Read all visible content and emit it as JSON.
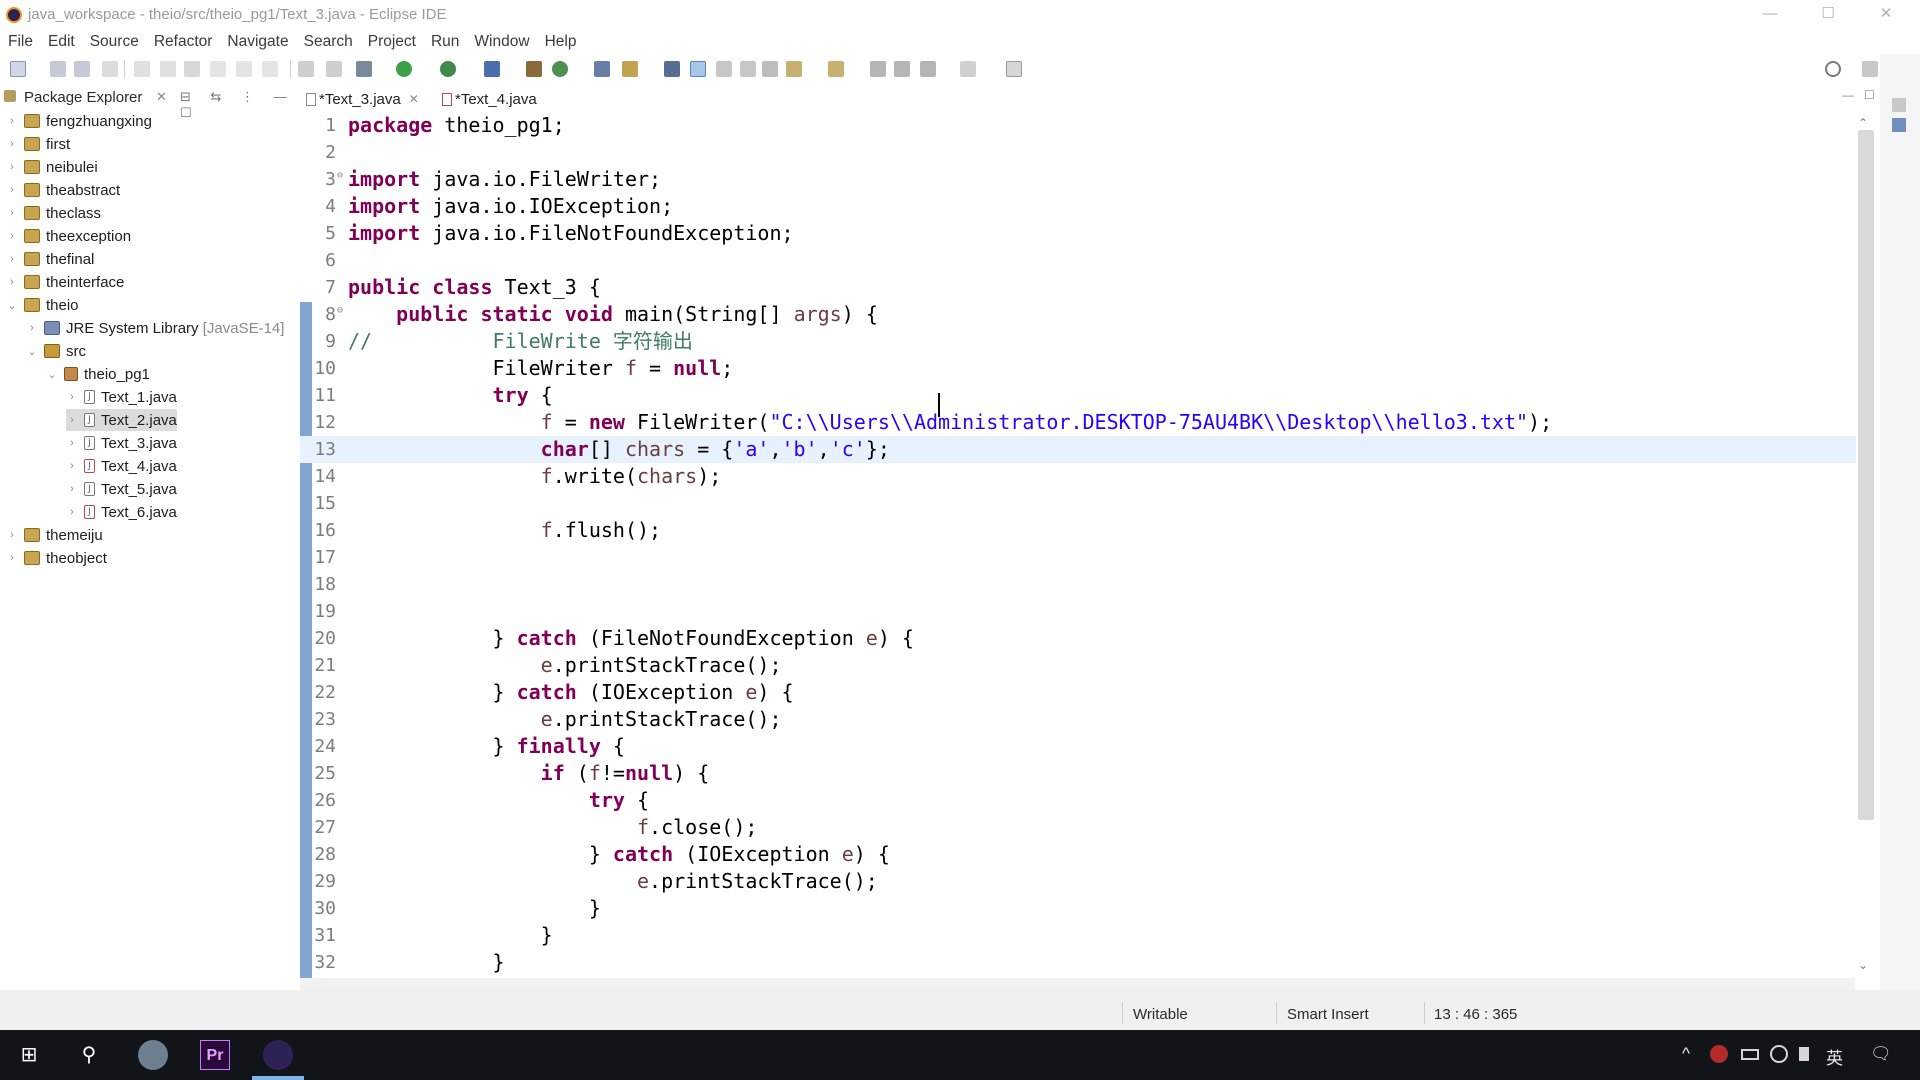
{
  "window": {
    "title": "java_workspace - theio/src/theio_pg1/Text_3.java - Eclipse IDE",
    "controls": {
      "minimize": "—",
      "maximize": "☐",
      "close": "✕"
    }
  },
  "menu": [
    "File",
    "Edit",
    "Source",
    "Refactor",
    "Navigate",
    "Search",
    "Project",
    "Run",
    "Window",
    "Help"
  ],
  "package_explorer": {
    "title": "Package Explorer",
    "close": "✕",
    "tools": "⊟ ⇆ ⋮ —  ☐",
    "tree": [
      {
        "label": "fengzhuangxing",
        "twisty": "›",
        "icon": "project-icon"
      },
      {
        "label": "first",
        "twisty": "›",
        "icon": "project-icon"
      },
      {
        "label": "neibulei",
        "twisty": "›",
        "icon": "project-icon"
      },
      {
        "label": "theabstract",
        "twisty": "›",
        "icon": "project-icon"
      },
      {
        "label": "theclass",
        "twisty": "›",
        "icon": "project-icon"
      },
      {
        "label": "theexception",
        "twisty": "›",
        "icon": "project-icon"
      },
      {
        "label": "thefinal",
        "twisty": "›",
        "icon": "project-icon"
      },
      {
        "label": "theinterface",
        "twisty": "›",
        "icon": "project-icon"
      },
      {
        "label": "theio",
        "twisty": "⌄",
        "icon": "project-icon"
      },
      {
        "label": "JRE System Library",
        "decoration": "[JavaSE-14]",
        "twisty": "›",
        "icon": "library-icon"
      },
      {
        "label": "src",
        "twisty": "⌄",
        "icon": "source-folder-icon"
      },
      {
        "label": "theio_pg1",
        "twisty": "⌄",
        "icon": "package-icon"
      },
      {
        "label": "Text_1.java",
        "twisty": "›",
        "icon": "java-file-icon"
      },
      {
        "label": "Text_2.java",
        "twisty": "›",
        "icon": "java-file-icon"
      },
      {
        "label": "Text_3.java",
        "twisty": "›",
        "icon": "java-file-icon"
      },
      {
        "label": "Text_4.java",
        "twisty": "›",
        "icon": "java-file-error-icon"
      },
      {
        "label": "Text_5.java",
        "twisty": "›",
        "icon": "java-file-icon"
      },
      {
        "label": "Text_6.java",
        "twisty": "›",
        "icon": "java-file-error-icon"
      },
      {
        "label": "themeiju",
        "twisty": "›",
        "icon": "project-icon"
      },
      {
        "label": "theobject",
        "twisty": "›",
        "icon": "project-icon"
      }
    ]
  },
  "editor": {
    "tabs": [
      {
        "label": "*Text_3.java",
        "close": "✕",
        "active": true
      },
      {
        "label": "*Text_4.java",
        "close": "",
        "active": false
      }
    ],
    "current_line": 13,
    "lines": [
      {
        "n": "1",
        "tokens": [
          {
            "t": "package",
            "c": "kw"
          },
          {
            "t": " theio_pg1;",
            "c": ""
          }
        ]
      },
      {
        "n": "2",
        "tokens": []
      },
      {
        "n": "3",
        "fold": "⊖",
        "tokens": [
          {
            "t": "import",
            "c": "kw"
          },
          {
            "t": " java.io.FileWriter;",
            "c": ""
          }
        ]
      },
      {
        "n": "4",
        "tokens": [
          {
            "t": "import",
            "c": "kw"
          },
          {
            "t": " java.io.IOException;",
            "c": ""
          }
        ]
      },
      {
        "n": "5",
        "tokens": [
          {
            "t": "import",
            "c": "kw"
          },
          {
            "t": " java.io.FileNotFoundException;",
            "c": ""
          }
        ]
      },
      {
        "n": "6",
        "tokens": []
      },
      {
        "n": "7",
        "tokens": [
          {
            "t": "public",
            "c": "kw"
          },
          {
            "t": " ",
            "c": ""
          },
          {
            "t": "class",
            "c": "kw"
          },
          {
            "t": " Text_3 {",
            "c": ""
          }
        ]
      },
      {
        "n": "8",
        "fold": "⊖",
        "tokens": [
          {
            "t": "    ",
            "c": ""
          },
          {
            "t": "public",
            "c": "kw"
          },
          {
            "t": " ",
            "c": ""
          },
          {
            "t": "static",
            "c": "kw"
          },
          {
            "t": " ",
            "c": ""
          },
          {
            "t": "void",
            "c": "kw"
          },
          {
            "t": " main(String[] ",
            "c": ""
          },
          {
            "t": "args",
            "c": "var"
          },
          {
            "t": ") {",
            "c": ""
          }
        ]
      },
      {
        "n": "9",
        "tokens": [
          {
            "t": "//          FileWrite 字符输出",
            "c": "cmt"
          }
        ]
      },
      {
        "n": "10",
        "tokens": [
          {
            "t": "            FileWriter ",
            "c": ""
          },
          {
            "t": "f",
            "c": "var"
          },
          {
            "t": " = ",
            "c": ""
          },
          {
            "t": "null",
            "c": "kw"
          },
          {
            "t": ";",
            "c": ""
          }
        ]
      },
      {
        "n": "11",
        "tokens": [
          {
            "t": "            ",
            "c": ""
          },
          {
            "t": "try",
            "c": "kw"
          },
          {
            "t": " {",
            "c": ""
          }
        ]
      },
      {
        "n": "12",
        "tokens": [
          {
            "t": "                ",
            "c": ""
          },
          {
            "t": "f",
            "c": "var"
          },
          {
            "t": " = ",
            "c": ""
          },
          {
            "t": "new",
            "c": "kw"
          },
          {
            "t": " FileWriter(",
            "c": ""
          },
          {
            "t": "\"C:\\\\Users\\\\Administrator.DESKTOP-75AU4BK\\\\Desktop\\\\hello3.txt\"",
            "c": "str"
          },
          {
            "t": ");",
            "c": ""
          }
        ]
      },
      {
        "n": "13",
        "tokens": [
          {
            "t": "                ",
            "c": ""
          },
          {
            "t": "char",
            "c": "kw"
          },
          {
            "t": "[] ",
            "c": ""
          },
          {
            "t": "chars",
            "c": "var"
          },
          {
            "t": " = {",
            "c": ""
          },
          {
            "t": "'a'",
            "c": "str"
          },
          {
            "t": ",",
            "c": ""
          },
          {
            "t": "'b'",
            "c": "str"
          },
          {
            "t": ",",
            "c": ""
          },
          {
            "t": "'c'",
            "c": "str"
          },
          {
            "t": "};",
            "c": ""
          }
        ]
      },
      {
        "n": "14",
        "tokens": [
          {
            "t": "                ",
            "c": ""
          },
          {
            "t": "f",
            "c": "var"
          },
          {
            "t": ".write(",
            "c": ""
          },
          {
            "t": "chars",
            "c": "var"
          },
          {
            "t": ");",
            "c": ""
          }
        ]
      },
      {
        "n": "15",
        "tokens": []
      },
      {
        "n": "16",
        "tokens": [
          {
            "t": "                ",
            "c": ""
          },
          {
            "t": "f",
            "c": "var"
          },
          {
            "t": ".flush();",
            "c": ""
          }
        ]
      },
      {
        "n": "17",
        "tokens": []
      },
      {
        "n": "18",
        "tokens": []
      },
      {
        "n": "19",
        "tokens": []
      },
      {
        "n": "20",
        "tokens": [
          {
            "t": "            } ",
            "c": ""
          },
          {
            "t": "catch",
            "c": "kw"
          },
          {
            "t": " (FileNotFoundException ",
            "c": ""
          },
          {
            "t": "e",
            "c": "var"
          },
          {
            "t": ") {",
            "c": ""
          }
        ]
      },
      {
        "n": "21",
        "tokens": [
          {
            "t": "                ",
            "c": ""
          },
          {
            "t": "e",
            "c": "var"
          },
          {
            "t": ".printStackTrace();",
            "c": ""
          }
        ]
      },
      {
        "n": "22",
        "tokens": [
          {
            "t": "            } ",
            "c": ""
          },
          {
            "t": "catch",
            "c": "kw"
          },
          {
            "t": " (IOException ",
            "c": ""
          },
          {
            "t": "e",
            "c": "var"
          },
          {
            "t": ") {",
            "c": ""
          }
        ]
      },
      {
        "n": "23",
        "tokens": [
          {
            "t": "                ",
            "c": ""
          },
          {
            "t": "e",
            "c": "var"
          },
          {
            "t": ".printStackTrace();",
            "c": ""
          }
        ]
      },
      {
        "n": "24",
        "tokens": [
          {
            "t": "            } ",
            "c": ""
          },
          {
            "t": "finally",
            "c": "kw"
          },
          {
            "t": " {",
            "c": ""
          }
        ]
      },
      {
        "n": "25",
        "tokens": [
          {
            "t": "                ",
            "c": ""
          },
          {
            "t": "if",
            "c": "kw"
          },
          {
            "t": " (",
            "c": ""
          },
          {
            "t": "f",
            "c": "var"
          },
          {
            "t": "!=",
            "c": ""
          },
          {
            "t": "null",
            "c": "kw"
          },
          {
            "t": ") {",
            "c": ""
          }
        ]
      },
      {
        "n": "26",
        "tokens": [
          {
            "t": "                    ",
            "c": ""
          },
          {
            "t": "try",
            "c": "kw"
          },
          {
            "t": " {",
            "c": ""
          }
        ]
      },
      {
        "n": "27",
        "tokens": [
          {
            "t": "                        ",
            "c": ""
          },
          {
            "t": "f",
            "c": "var"
          },
          {
            "t": ".close();",
            "c": ""
          }
        ]
      },
      {
        "n": "28",
        "tokens": [
          {
            "t": "                    } ",
            "c": ""
          },
          {
            "t": "catch",
            "c": "kw"
          },
          {
            "t": " (IOException ",
            "c": ""
          },
          {
            "t": "e",
            "c": "var"
          },
          {
            "t": ") {",
            "c": ""
          }
        ]
      },
      {
        "n": "29",
        "tokens": [
          {
            "t": "                        ",
            "c": ""
          },
          {
            "t": "e",
            "c": "var"
          },
          {
            "t": ".printStackTrace();",
            "c": ""
          }
        ]
      },
      {
        "n": "30",
        "tokens": [
          {
            "t": "                    }",
            "c": ""
          }
        ]
      },
      {
        "n": "31",
        "tokens": [
          {
            "t": "                }",
            "c": ""
          }
        ]
      },
      {
        "n": "32",
        "tokens": [
          {
            "t": "            }",
            "c": ""
          }
        ]
      }
    ],
    "scroll_up": "⌃",
    "scroll_down": "⌄"
  },
  "statusbar": {
    "writable": "Writable",
    "insert_mode": "Smart Insert",
    "position": "13 : 46 : 365"
  },
  "taskbar": {
    "start": "⊞",
    "search": "⚲",
    "apps": [
      "browser-icon",
      "premiere-icon",
      "eclipse-icon"
    ],
    "premiere_label": "Pr",
    "tray": {
      "chevron": "^",
      "ime": "英",
      "notification": "🗨"
    }
  },
  "colors": {
    "keyword": "#7f0055",
    "string": "#2a00ff",
    "comment": "#3f7f5f",
    "variable": "#6a3e3e",
    "current_line": "#e8f2fe",
    "selection": "#dcdcdc",
    "ruler": "#6c97c8"
  }
}
